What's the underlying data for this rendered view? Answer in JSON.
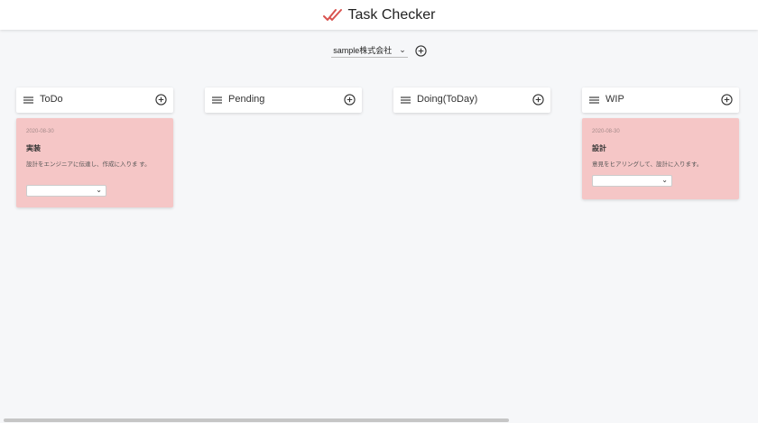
{
  "app": {
    "title": "Task Checker"
  },
  "company": {
    "selected": "sample株式会社"
  },
  "columns": [
    {
      "name": "ToDo"
    },
    {
      "name": "Pending"
    },
    {
      "name": "Doing(ToDay)"
    },
    {
      "name": "WIP"
    }
  ],
  "cards": {
    "todo": {
      "date": "2020-08-30",
      "title": "実装",
      "description": "設計をエンジニアに伝達し、作成に入りま す。",
      "status": ""
    },
    "wip": {
      "date": "2020-08-30",
      "title": "設計",
      "description": "意見をヒアリングして、設計に入ります。",
      "status": ""
    }
  },
  "colors": {
    "accent": "#d9534f",
    "card_bg": "#f5c6c6",
    "page_bg": "#f6f7f9"
  }
}
